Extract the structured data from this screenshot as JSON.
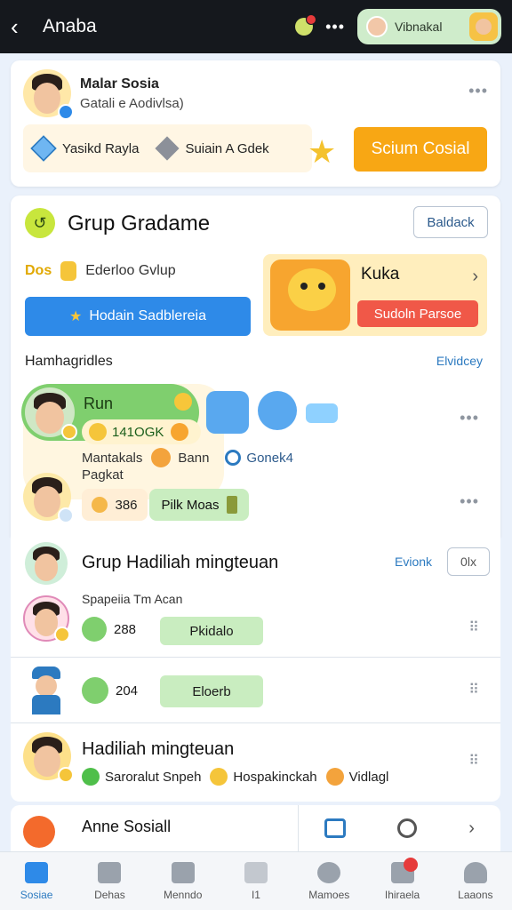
{
  "header": {
    "back_icon": "chevron-left-icon",
    "title": "Anaba",
    "user_name": "Vibnakal"
  },
  "profile": {
    "name": "Malar Sosia",
    "subtitle": "Gatali e Aodivlsa)",
    "items": [
      "Yasikd Rayla",
      "Suiain A Gdek"
    ],
    "cta": "Scium Cosial"
  },
  "group": {
    "title": "Grup Gradame",
    "button": "Baldack",
    "status_tag": "Dos",
    "status_text": "Ederloo Gvlup",
    "action": "Hodain Sadblereia",
    "promo_title": "Kuka",
    "promo_button": "Sudoln Parsoe",
    "section_heading": "Hamhagridles",
    "section_link": "Elvidcey",
    "row1_name": "Run",
    "row1_score": "141OGK",
    "row1_line": "Mantakals",
    "row1_extra": "Bann",
    "row1_link": "Gonek4",
    "row1_sub": "Pagkat",
    "row2_value": "386",
    "row2_pill": "Pilk Moas"
  },
  "list": {
    "l1_title": "Grup Hadiliah mingteuan",
    "l1_link": "Evionk",
    "l1_button": "0lx",
    "l1_sub": "Spapeiia Tm Acan",
    "l1_value": "288",
    "l1_pill": "Pkidalo",
    "l2_value": "204",
    "l2_pill": "Eloerb",
    "l3_title": "Hadiliah mingteuan",
    "l3_items": [
      "Saroralut Snpeh",
      "Hospakinckah",
      "Vidlagl"
    ]
  },
  "card4": {
    "title": "Anne Sosiall"
  },
  "nav": [
    {
      "label": "Sosiae",
      "icon": "home-icon"
    },
    {
      "label": "Dehas",
      "icon": "house-icon"
    },
    {
      "label": "Menndo",
      "icon": "document-icon"
    },
    {
      "label": "I1",
      "icon": "bird-icon"
    },
    {
      "label": "Mamoes",
      "icon": "game-icon"
    },
    {
      "label": "Ihiraela",
      "icon": "notification-icon"
    },
    {
      "label": "Laaons",
      "icon": "person-icon"
    }
  ],
  "colors": {
    "accent": "#2e8ae8",
    "cta": "#f8a714",
    "green": "#7fcf6e",
    "promo_button": "#f05848"
  }
}
